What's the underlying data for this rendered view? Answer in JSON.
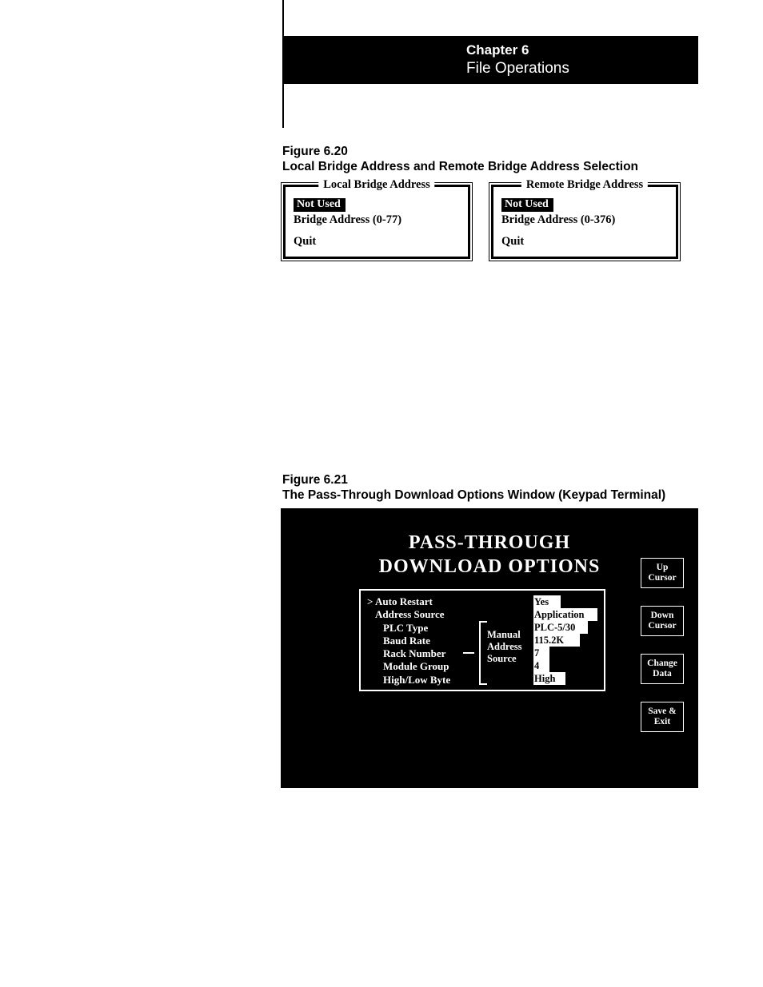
{
  "header": {
    "chapter": "Chapter 6",
    "title": "File Operations"
  },
  "figure1": {
    "label": "Figure 6.20",
    "caption": "Local Bridge Address and Remote Bridge Address Selection",
    "local": {
      "legend": "Local Bridge Address",
      "not_used": "Not Used",
      "range": "Bridge Address (0-77)",
      "quit": "Quit"
    },
    "remote": {
      "legend": "Remote Bridge Address",
      "not_used": "Not Used",
      "range": "Bridge Address (0-376)",
      "quit": "Quit"
    }
  },
  "figure2": {
    "label": "Figure 6.21",
    "caption": "The Pass-Through Download Options Window (Keypad Terminal)",
    "window_title_l1": "PASS-THROUGH",
    "window_title_l2": "DOWNLOAD OPTIONS",
    "options": {
      "cursor": ">",
      "rows": {
        "auto_restart": "Auto Restart",
        "address_source": "Address Source",
        "plc_type": "PLC Type",
        "baud_rate": "Baud Rate",
        "rack_number": "Rack Number",
        "module_group": "Module Group",
        "high_low_byte": "High/Low Byte"
      },
      "bracket_label_l1": "Manual",
      "bracket_label_l2": "Address",
      "bracket_label_l3": "Source",
      "values": {
        "auto_restart": "Yes",
        "address_source": "Application",
        "plc_type": "PLC-5/30",
        "baud_rate": "115.2K",
        "rack_number": "7",
        "module_group": "4",
        "high_low_byte": "High"
      }
    },
    "softkeys": {
      "up": "Up Cursor",
      "down": "Down Cursor",
      "change": "Change Data",
      "save": "Save & Exit"
    }
  }
}
